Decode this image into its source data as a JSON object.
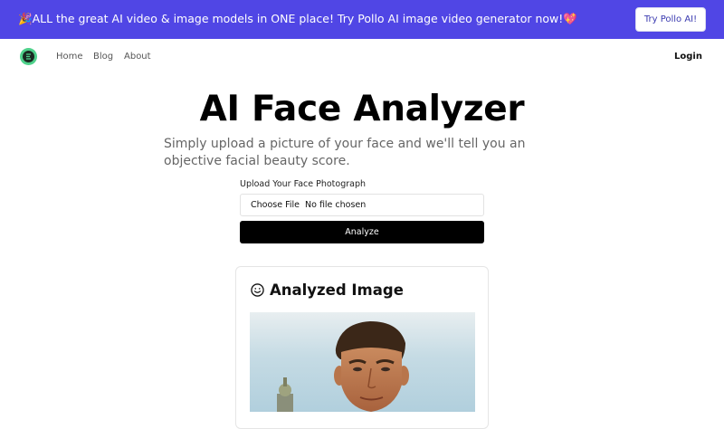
{
  "banner": {
    "text": "🎉ALL the great AI video & image models in ONE place! Try Pollo AI image video generator now!💖",
    "button_label": "Try Pollo AI!"
  },
  "nav": {
    "logo_icon": "logo-icon",
    "links": [
      "Home",
      "Blog",
      "About"
    ],
    "login_label": "Login"
  },
  "hero": {
    "title": "AI Face Analyzer",
    "subtitle": "Simply upload a picture of your face and we'll tell you an objective facial beauty score."
  },
  "upload": {
    "label": "Upload Your Face Photograph",
    "choose_file_label": "Choose File",
    "file_status": "No file chosen",
    "analyze_label": "Analyze"
  },
  "result_card": {
    "icon": "smile-icon",
    "title": "Analyzed Image",
    "image_icon": "face-photo"
  },
  "colors": {
    "banner_bg": "#5046e5",
    "primary_button": "#000000",
    "logo_accent": "#4fd18b"
  }
}
